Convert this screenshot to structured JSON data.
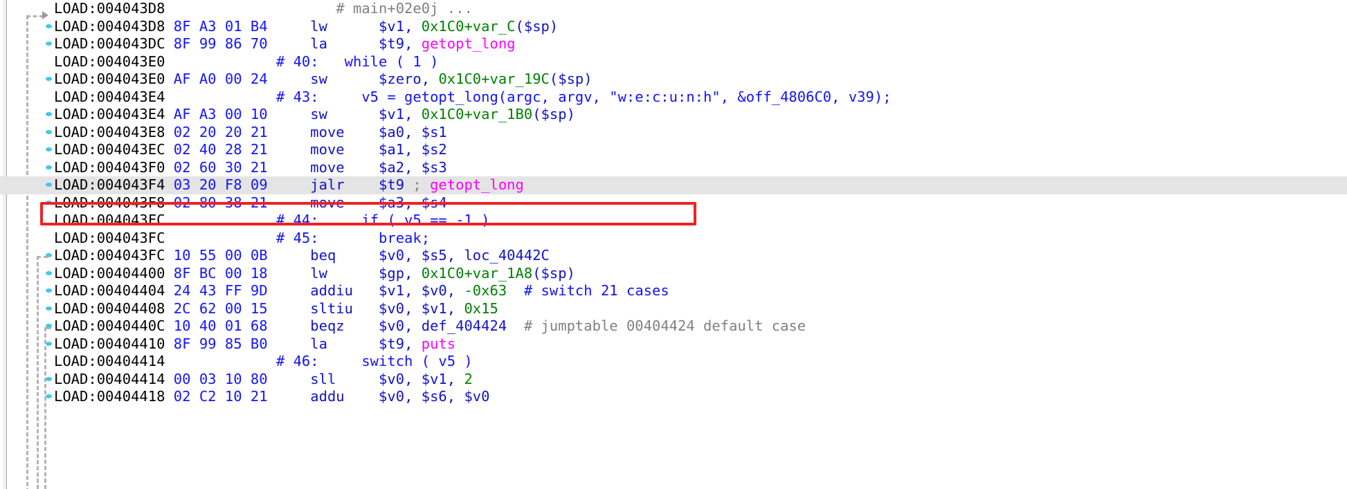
{
  "app": {
    "name": "IDA Pro disassembly listing",
    "segment": "LOAD",
    "architecture": "MIPS"
  },
  "annotation": {
    "type": "red-rectangle",
    "color": "#ee2222",
    "target_line": "LOAD:004043F4 03 20 F8 09            jalr    $t9 ; getopt_long"
  },
  "colors": {
    "background": "#ffffff",
    "address": "#000000",
    "hex_bytes": "#1414ff",
    "mnemonic": "#1212c8",
    "stack_variable": "#008000",
    "external_function": "#ff00ff",
    "pseudocode_comment": "#1212ff",
    "trailing_comment": "#808080",
    "selected_row": "#e4e4e4",
    "gutter_dot": "#3ec8f0",
    "flow_line": "#b4b4b4"
  },
  "lines": [
    {
      "id": "l0",
      "clipped_top": true,
      "dot": false,
      "address": "LOAD:004043D8",
      "bytes": "",
      "mnemonic": "",
      "operands": "",
      "comment": "# main+02e0j ...",
      "raw": "LOAD:004043D8                                           # main+02e0j ..."
    },
    {
      "id": "l1",
      "dot": true,
      "address": "LOAD:004043D8",
      "bytes": "8F A3 01 B4",
      "mnemonic": "lw",
      "operands": "$v1, 0x1C0+var_C($sp)",
      "comment": ""
    },
    {
      "id": "l2",
      "dot": true,
      "address": "LOAD:004043DC",
      "bytes": "8F 99 86 70",
      "mnemonic": "la",
      "operands": "$t9, getopt_long",
      "comment": ""
    },
    {
      "id": "l3",
      "dot": false,
      "address": "LOAD:004043E0",
      "bytes": "",
      "pseudo": "# 40:   while ( 1 )"
    },
    {
      "id": "l4",
      "dot": true,
      "address": "LOAD:004043E0",
      "bytes": "AF A0 00 24",
      "mnemonic": "sw",
      "operands": "$zero, 0x1C0+var_19C($sp)",
      "comment": ""
    },
    {
      "id": "l5",
      "dot": false,
      "address": "LOAD:004043E4",
      "bytes": "",
      "pseudo": "# 43:     v5 = getopt_long(argc, argv, \"w:e:c:u:n:h\", &off_4806C0, v39);"
    },
    {
      "id": "l6",
      "dot": true,
      "address": "LOAD:004043E4",
      "bytes": "AF A3 00 10",
      "mnemonic": "sw",
      "operands": "$v1, 0x1C0+var_1B0($sp)",
      "comment": ""
    },
    {
      "id": "l7",
      "dot": true,
      "address": "LOAD:004043E8",
      "bytes": "02 20 20 21",
      "mnemonic": "move",
      "operands": "$a0, $s1",
      "comment": ""
    },
    {
      "id": "l8",
      "dot": true,
      "address": "LOAD:004043EC",
      "bytes": "02 40 28 21",
      "mnemonic": "move",
      "operands": "$a1, $s2",
      "comment": ""
    },
    {
      "id": "l9",
      "dot": true,
      "address": "LOAD:004043F0",
      "bytes": "02 60 30 21",
      "mnemonic": "move",
      "operands": "$a2, $s3",
      "comment": ""
    },
    {
      "id": "l10",
      "dot": true,
      "selected": true,
      "address": "LOAD:004043F4",
      "bytes": "03 20 F8 09",
      "mnemonic": "jalr",
      "operands": "$t9 ; getopt_long",
      "comment": ""
    },
    {
      "id": "l11",
      "dot": true,
      "address": "LOAD:004043F8",
      "bytes": "02 80 38 21",
      "mnemonic": "move",
      "operands": "$a3, $s4",
      "comment": ""
    },
    {
      "id": "l12",
      "dot": false,
      "address": "LOAD:004043FC",
      "bytes": "",
      "pseudo": "# 44:     if ( v5 == -1 )"
    },
    {
      "id": "l13",
      "dot": false,
      "address": "LOAD:004043FC",
      "bytes": "",
      "pseudo": "# 45:       break;"
    },
    {
      "id": "l14",
      "dot": true,
      "address": "LOAD:004043FC",
      "bytes": "10 55 00 0B",
      "mnemonic": "beq",
      "operands": "$v0, $s5, loc_40442C",
      "comment": ""
    },
    {
      "id": "l15",
      "dot": true,
      "address": "LOAD:00404400",
      "bytes": "8F BC 00 18",
      "mnemonic": "lw",
      "operands": "$gp, 0x1C0+var_1A8($sp)",
      "comment": ""
    },
    {
      "id": "l16",
      "dot": true,
      "address": "LOAD:00404404",
      "bytes": "24 43 FF 9D",
      "mnemonic": "addiu",
      "operands": "$v1, $v0, -0x63",
      "comment": "# switch 21 cases",
      "comment_style": "blue"
    },
    {
      "id": "l17",
      "dot": true,
      "address": "LOAD:00404408",
      "bytes": "2C 62 00 15",
      "mnemonic": "sltiu",
      "operands": "$v0, $v1, 0x15",
      "comment": ""
    },
    {
      "id": "l18",
      "dot": true,
      "address": "LOAD:0040440C",
      "bytes": "10 40 01 68",
      "mnemonic": "beqz",
      "operands": "$v0, def_404424",
      "comment": "# jumptable 00404424 default case",
      "comment_style": "gray"
    },
    {
      "id": "l19",
      "dot": true,
      "address": "LOAD:00404410",
      "bytes": "8F 99 85 B0",
      "mnemonic": "la",
      "operands": "$t9, puts",
      "comment": ""
    },
    {
      "id": "l20",
      "dot": false,
      "address": "LOAD:00404414",
      "bytes": "",
      "pseudo": "# 46:     switch ( v5 )"
    },
    {
      "id": "l21",
      "dot": true,
      "address": "LOAD:00404414",
      "bytes": "00 03 10 80",
      "mnemonic": "sll",
      "operands": "$v0, $v1, 2",
      "comment": ""
    },
    {
      "id": "l22",
      "dot": true,
      "clipped_bottom": true,
      "address": "LOAD:00404418",
      "bytes": "02 C2 10 21",
      "mnemonic": "addu",
      "operands": "$v0, $s6, $v0",
      "comment": ""
    }
  ]
}
